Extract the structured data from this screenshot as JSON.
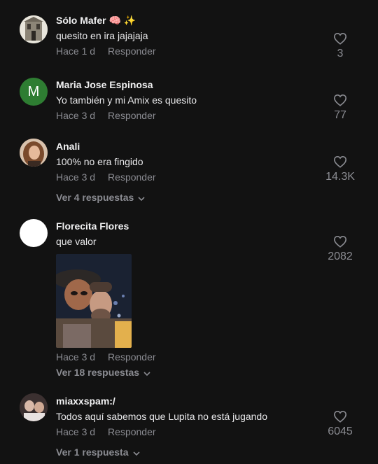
{
  "comments": [
    {
      "name": "Sólo Mafer 🧠 ✨",
      "text": "quesito en ira jajajaja",
      "time": "Hace 1 d",
      "reply": "Responder",
      "likes": "3"
    },
    {
      "name": "Maria Jose Espinosa",
      "avatar_letter": "M",
      "text": "Yo también y mi Amix es quesito",
      "time": "Hace 3 d",
      "reply": "Responder",
      "likes": "77"
    },
    {
      "name": "Anali",
      "text": "100% no era fingido",
      "time": "Hace 3 d",
      "reply": "Responder",
      "likes": "14.3K",
      "view_replies": "Ver 4 respuestas"
    },
    {
      "name": "Florecita Flores",
      "text": "que valor",
      "time": "Hace 3 d",
      "reply": "Responder",
      "likes": "2082",
      "view_replies": "Ver 18 respuestas"
    },
    {
      "name": "miaxxspam:/",
      "text": "Todos aquí sabemos que Lupita no está jugando",
      "time": "Hace 3 d",
      "reply": "Responder",
      "likes": "6045",
      "view_replies": "Ver 1 respuesta"
    }
  ],
  "colors": {
    "background": "#121212",
    "muted": "#8a8b91",
    "avatar_green": "#2e7d32"
  },
  "icons": {
    "like": "heart-outline-icon",
    "expand": "chevron-down-icon"
  }
}
